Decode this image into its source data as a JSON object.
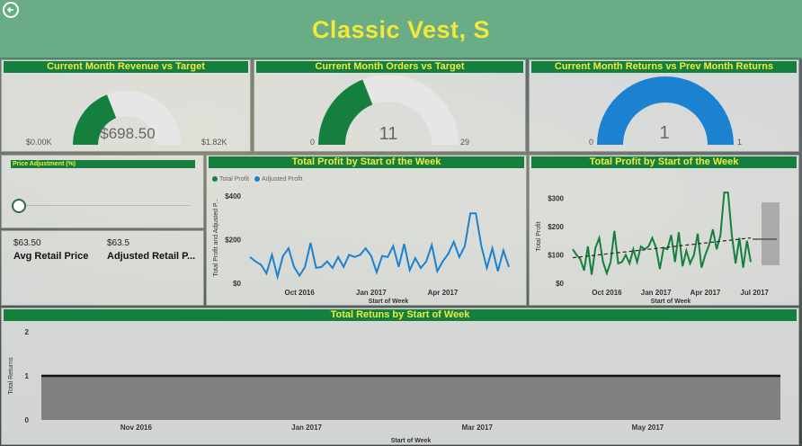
{
  "header": {
    "title": "Classic Vest, S",
    "back_icon": "back-arrow-icon"
  },
  "revenue_gauge": {
    "title": "Current Month Revenue vs Target",
    "value_label": "$698.50",
    "min_label": "$0.00K",
    "max_label": "$1.82K",
    "fraction": 0.38,
    "color": "#15803d"
  },
  "orders_gauge": {
    "title": "Current Month Orders vs Target",
    "value_label": "11",
    "min_label": "0",
    "max_label": "29",
    "fraction": 0.38,
    "color": "#15803d"
  },
  "returns_gauge": {
    "title": "Current Month Returns vs Prev Month Returns",
    "value_label": "1",
    "min_label": "0",
    "max_label": "1",
    "fraction": 1.0,
    "color": "#1a82d1"
  },
  "slicer": {
    "title": "Price Adjustment (%)",
    "value_fraction": 0.0
  },
  "cards": {
    "avg_value": "$63.50",
    "avg_label": "Avg Retail Price",
    "adj_value": "$63.5",
    "adj_label": "Adjusted Retail P..."
  },
  "colors": {
    "header_bg": "#6aac86",
    "title_green": "#15803d",
    "title_yellow": "#f3ea3b",
    "adjusted_blue": "#1a82d1"
  },
  "chart_data": [
    {
      "type": "line",
      "title": "Total Profit by Start of the Week",
      "legend": [
        "Total Profit",
        "Adjusted Profit"
      ],
      "xlabel": "Start of Week",
      "ylabel": "Total Profit and Adjusted P...",
      "ytick_labels": [
        "$400",
        "$200",
        "$0"
      ],
      "yticks": [
        400,
        200,
        0
      ],
      "ylim": [
        0,
        420
      ],
      "xtick_labels": [
        "Oct 2016",
        "Jan 2017",
        "Apr 2017"
      ],
      "xtick_positions": [
        9,
        22,
        35
      ],
      "series": [
        {
          "name": "Adjusted Profit",
          "color": "#1a82d1",
          "values": [
            120,
            100,
            85,
            45,
            130,
            30,
            125,
            160,
            75,
            35,
            75,
            185,
            70,
            75,
            100,
            70,
            120,
            75,
            130,
            120,
            130,
            160,
            125,
            50,
            125,
            120,
            170,
            75,
            180,
            60,
            115,
            70,
            100,
            175,
            55,
            100,
            135,
            190,
            120,
            170,
            320,
            320,
            170,
            70,
            160,
            55,
            150,
            75
          ]
        }
      ]
    },
    {
      "type": "line",
      "title": "Total Profit by Start of the Week",
      "xlabel": "Start of Week",
      "ylabel": "Total Profit",
      "ytick_labels": [
        "$300",
        "$200",
        "$100",
        "$0"
      ],
      "yticks": [
        300,
        200,
        100,
        0
      ],
      "ylim": [
        0,
        330
      ],
      "xtick_labels": [
        "Oct 2016",
        "Jan 2017",
        "Apr 2017",
        "Jul 2017"
      ],
      "xtick_positions": [
        9,
        22,
        35,
        48
      ],
      "series": [
        {
          "name": "Total Profit",
          "color": "#15803d",
          "values": [
            120,
            100,
            85,
            45,
            130,
            30,
            125,
            160,
            75,
            35,
            75,
            185,
            70,
            75,
            100,
            70,
            120,
            75,
            130,
            120,
            130,
            160,
            125,
            50,
            125,
            120,
            170,
            75,
            180,
            60,
            115,
            70,
            100,
            175,
            55,
            100,
            135,
            190,
            120,
            170,
            320,
            320,
            170,
            70,
            160,
            55,
            150,
            75
          ]
        }
      ],
      "trend": [
        90,
        160
      ]
    },
    {
      "type": "area",
      "title": "Total Retuns by Start of Week",
      "xlabel": "Start of Week",
      "ylabel": "Total Returns",
      "ytick_labels": [
        "2",
        "1",
        "0"
      ],
      "yticks": [
        2,
        1,
        0
      ],
      "ylim": [
        0,
        2
      ],
      "xtick_labels": [
        "Nov 2016",
        "Jan 2017",
        "Mar 2017",
        "May 2017"
      ],
      "xtick_positions": [
        5,
        14,
        23,
        32
      ],
      "x_count": 40,
      "series": [
        {
          "values": [
            1,
            1
          ]
        }
      ]
    }
  ]
}
